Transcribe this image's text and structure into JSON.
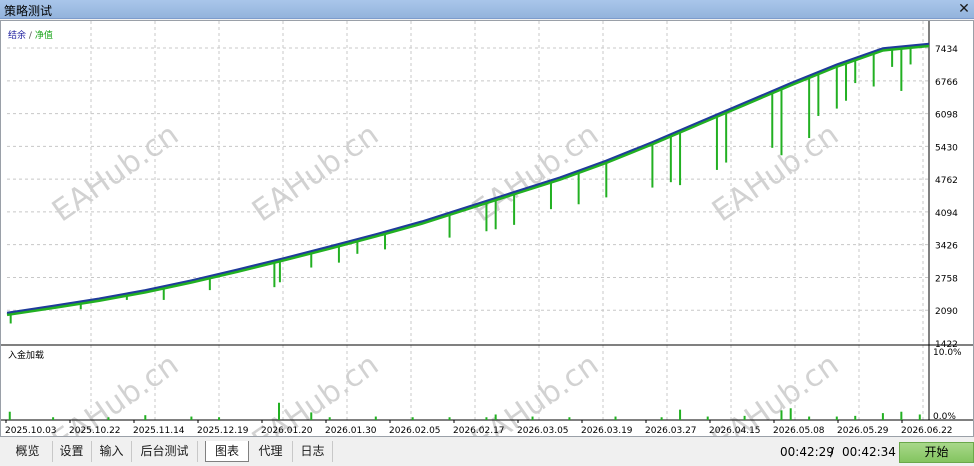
{
  "window": {
    "title": "策略测试",
    "close_glyph": "✕"
  },
  "colors": {
    "balance": "#1f3b9a",
    "equity": "#22b022",
    "deposit": "#22b022",
    "grid": "#c8c8c8",
    "watermark": "#d2d2d2"
  },
  "watermark": "EAHub.cn",
  "chart_data": {
    "type": "line",
    "legend": {
      "balance": "结余",
      "separator": "/",
      "equity": "净值"
    },
    "y_ticks": [
      1422,
      2090,
      2758,
      3426,
      4094,
      4762,
      5430,
      6098,
      6766,
      7434
    ],
    "ylim": [
      1422,
      7700
    ],
    "x_ticks": [
      "2025.10.03",
      "2025.10.22",
      "2025.11.14",
      "2025.12.19",
      "2026.01.20",
      "2026.01.30",
      "2026.02.05",
      "2026.02.17",
      "2026.03.05",
      "2026.03.19",
      "2026.03.27",
      "2026.04.15",
      "2026.05.08",
      "2026.05.29",
      "2026.06.22"
    ],
    "series": [
      {
        "name": "结余",
        "x": [
          0,
          5,
          10,
          15,
          20,
          25,
          30,
          35,
          40,
          45,
          50,
          55,
          60,
          65,
          70,
          75,
          80,
          85,
          90,
          95,
          100
        ],
        "y": [
          2040,
          2180,
          2330,
          2500,
          2700,
          2920,
          3150,
          3390,
          3640,
          3900,
          4200,
          4500,
          4800,
          5140,
          5520,
          5920,
          6320,
          6720,
          7100,
          7430,
          7520
        ]
      },
      {
        "name": "净值",
        "drawdowns": [
          {
            "x": 0.4,
            "y": 1820
          },
          {
            "x": 8,
            "y": 2110
          },
          {
            "x": 13,
            "y": 2300
          },
          {
            "x": 17,
            "y": 2300
          },
          {
            "x": 22,
            "y": 2500
          },
          {
            "x": 29,
            "y": 2560
          },
          {
            "x": 29.6,
            "y": 2660
          },
          {
            "x": 33,
            "y": 2960
          },
          {
            "x": 36,
            "y": 3060
          },
          {
            "x": 38,
            "y": 3240
          },
          {
            "x": 41,
            "y": 3330
          },
          {
            "x": 48,
            "y": 3570
          },
          {
            "x": 52,
            "y": 3700
          },
          {
            "x": 53,
            "y": 3740
          },
          {
            "x": 55,
            "y": 3830
          },
          {
            "x": 59,
            "y": 4150
          },
          {
            "x": 62,
            "y": 4250
          },
          {
            "x": 65,
            "y": 4390
          },
          {
            "x": 70,
            "y": 4590
          },
          {
            "x": 72,
            "y": 4700
          },
          {
            "x": 73,
            "y": 4640
          },
          {
            "x": 77,
            "y": 4950
          },
          {
            "x": 78,
            "y": 5100
          },
          {
            "x": 83,
            "y": 5400
          },
          {
            "x": 84,
            "y": 5250
          },
          {
            "x": 87,
            "y": 5600
          },
          {
            "x": 88,
            "y": 6050
          },
          {
            "x": 90,
            "y": 6200
          },
          {
            "x": 91,
            "y": 6360
          },
          {
            "x": 92,
            "y": 6720
          },
          {
            "x": 94,
            "y": 6650
          },
          {
            "x": 96,
            "y": 7050
          },
          {
            "x": 97,
            "y": 6560
          },
          {
            "x": 98,
            "y": 7100
          }
        ]
      }
    ],
    "sub_chart": {
      "title": "入金加载",
      "y_ticks": [
        "10.0%",
        "0.0%"
      ],
      "ylim": [
        0,
        10
      ],
      "bars": [
        {
          "x": 0.3,
          "v": 1.2
        },
        {
          "x": 5,
          "v": 0.4
        },
        {
          "x": 11,
          "v": 0.4
        },
        {
          "x": 15,
          "v": 0.7
        },
        {
          "x": 20,
          "v": 0.5
        },
        {
          "x": 23,
          "v": 0.4
        },
        {
          "x": 29.5,
          "v": 2.5
        },
        {
          "x": 33,
          "v": 1.1
        },
        {
          "x": 35,
          "v": 0.4
        },
        {
          "x": 40,
          "v": 0.5
        },
        {
          "x": 44,
          "v": 0.4
        },
        {
          "x": 48,
          "v": 0.4
        },
        {
          "x": 52,
          "v": 0.4
        },
        {
          "x": 53,
          "v": 0.8
        },
        {
          "x": 57,
          "v": 0.5
        },
        {
          "x": 61,
          "v": 0.4
        },
        {
          "x": 66,
          "v": 0.5
        },
        {
          "x": 71,
          "v": 0.4
        },
        {
          "x": 73,
          "v": 1.5
        },
        {
          "x": 76,
          "v": 0.5
        },
        {
          "x": 80,
          "v": 0.6
        },
        {
          "x": 84,
          "v": 1.4
        },
        {
          "x": 85,
          "v": 1.7
        },
        {
          "x": 87,
          "v": 0.5
        },
        {
          "x": 90,
          "v": 0.5
        },
        {
          "x": 92,
          "v": 0.6
        },
        {
          "x": 95,
          "v": 1.0
        },
        {
          "x": 97,
          "v": 1.2
        },
        {
          "x": 99,
          "v": 0.8
        }
      ]
    }
  },
  "tabs": [
    {
      "label": "概览",
      "active": false
    },
    {
      "label": "设置",
      "active": false
    },
    {
      "label": "输入",
      "active": false
    },
    {
      "label": "后台测试",
      "active": false
    },
    {
      "label": "图表",
      "active": true
    },
    {
      "label": "代理",
      "active": false
    },
    {
      "label": "日志",
      "active": false
    }
  ],
  "status": {
    "elapsed": "00:42:29",
    "separator": "/",
    "total": "00:42:34"
  },
  "start_button_label": "开始"
}
